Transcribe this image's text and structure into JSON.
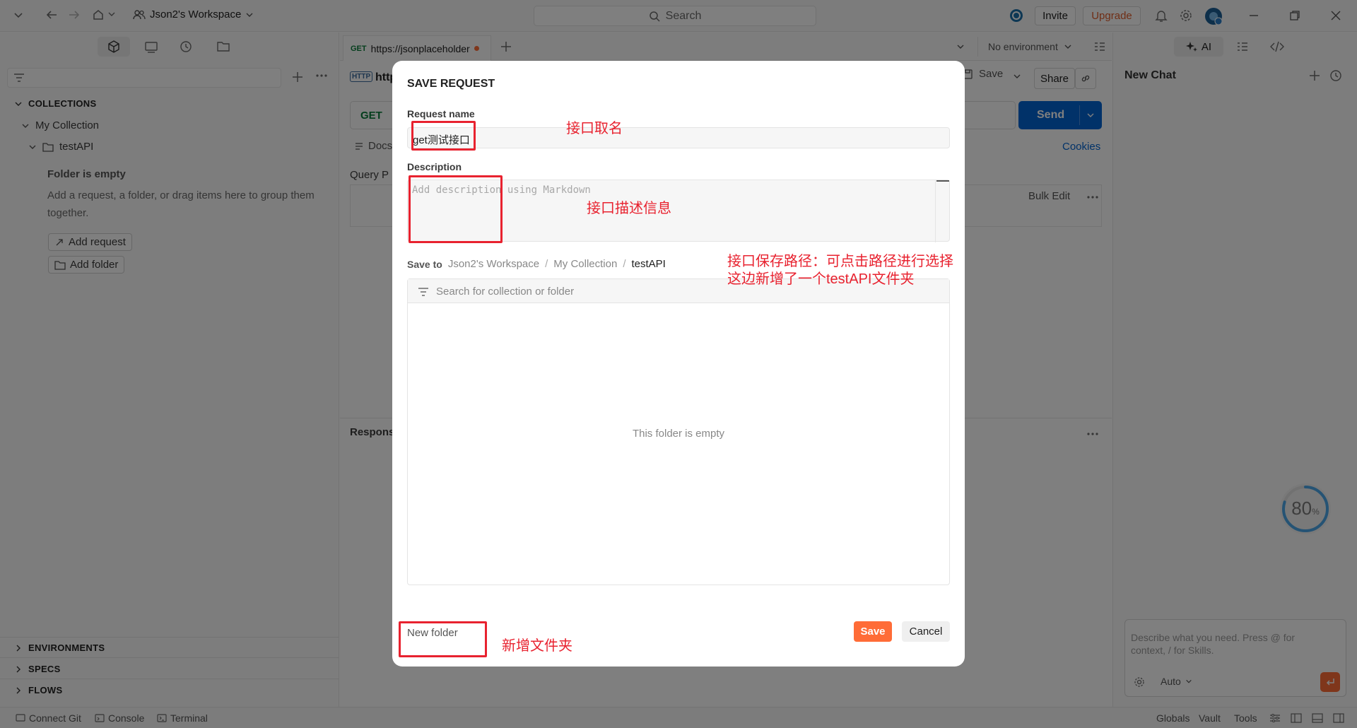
{
  "topbar": {
    "workspace": "Json2's Workspace",
    "search": "Search",
    "invite": "Invite",
    "upgrade": "Upgrade"
  },
  "tabs": {
    "active_method": "GET",
    "active_url": "https://jsonplaceholder",
    "environment": "No environment"
  },
  "sidebar": {
    "collections_label": "COLLECTIONS",
    "collection_name": "My Collection",
    "folder_name": "testAPI",
    "empty_title": "Folder is empty",
    "empty_desc": "Add a request, a folder, or drag items here to group them together.",
    "add_request": "Add request",
    "add_folder": "Add folder",
    "environments": "ENVIRONMENTS",
    "specs": "SPECS",
    "flows": "FLOWS"
  },
  "request": {
    "protocol_icon": "HTTP",
    "url_partial": "http",
    "method": "GET",
    "save": "Save",
    "share": "Share",
    "send": "Send",
    "docs": "Docs",
    "cookies": "Cookies",
    "query_params": "Query P",
    "bulk_edit": "Bulk Edit",
    "response": "Respons"
  },
  "right_panel": {
    "ai": "AI",
    "title": "New Chat",
    "chat_placeholder": "Describe what you need. Press @ for context, / for Skills.",
    "model": "Auto"
  },
  "progress": {
    "value": "80",
    "unit": "%",
    "fraction": 0.8
  },
  "statusbar": {
    "connect_git": "Connect Git",
    "console": "Console",
    "terminal": "Terminal",
    "globals": "Globals",
    "vault": "Vault",
    "tools": "Tools"
  },
  "modal": {
    "title": "SAVE REQUEST",
    "name_label": "Request name",
    "name_value": "get测试接口",
    "desc_label": "Description",
    "desc_placeholder": "Add description using Markdown",
    "save_to_label": "Save to",
    "path": [
      "Json2's Workspace",
      "My Collection",
      "testAPI"
    ],
    "path_sep": "/",
    "search_placeholder": "Search for collection or folder",
    "empty_text": "This folder is empty",
    "new_folder": "New folder",
    "save": "Save",
    "cancel": "Cancel"
  },
  "annotations": {
    "name": "接口取名",
    "desc": "接口描述信息",
    "path_line1": "接口保存路径：可点击路径进行选择",
    "path_line2": "这边新增了一个testAPI文件夹",
    "new_folder": "新增文件夹"
  },
  "colors": {
    "accent_orange": "#ff6c37",
    "send_blue": "#0265d2",
    "annotation_red": "#e8222f"
  }
}
